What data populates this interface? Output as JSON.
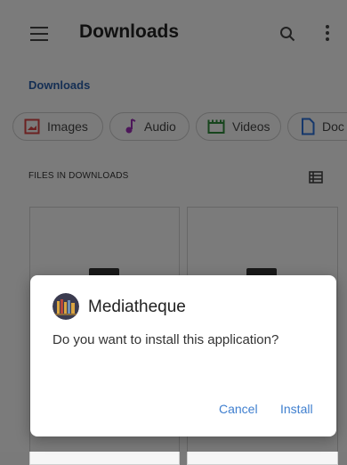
{
  "header": {
    "title": "Downloads"
  },
  "breadcrumb": "Downloads",
  "filters": [
    {
      "label": "Images",
      "icon": "image-icon",
      "color": "#d64545"
    },
    {
      "label": "Audio",
      "icon": "music-note-icon",
      "color": "#9b2fb5"
    },
    {
      "label": "Videos",
      "icon": "clapperboard-icon",
      "color": "#2e8b3a"
    },
    {
      "label": "Doc",
      "icon": "document-icon",
      "color": "#2a6fd6"
    }
  ],
  "section": {
    "label": "FILES IN DOWNLOADS"
  },
  "dialog": {
    "app_name": "Mediatheque",
    "message": "Do you want to install this application?",
    "cancel_label": "Cancel",
    "install_label": "Install"
  },
  "colors": {
    "accent": "#3f7fcf",
    "link": "#2a5fa8"
  }
}
